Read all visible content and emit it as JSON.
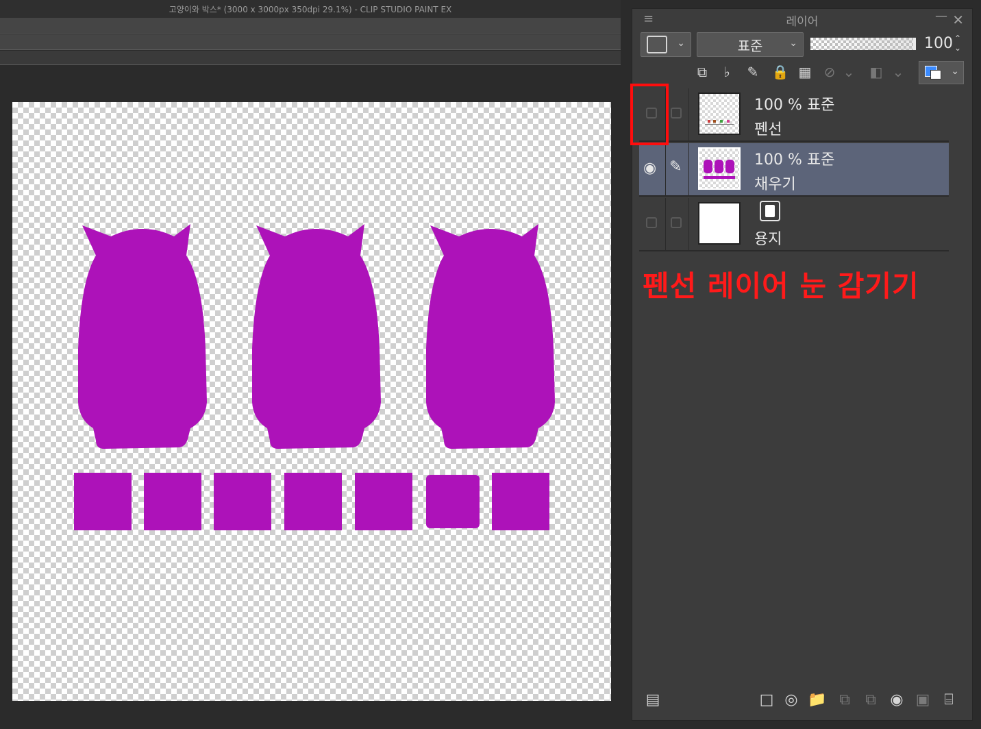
{
  "window": {
    "title": "고양이와 박스* (3000 x 3000px 350dpi 29.1%)  - CLIP STUDIO PAINT EX"
  },
  "layer_panel": {
    "title": "레이어",
    "blend_mode": "표준",
    "opacity": "100",
    "layers": [
      {
        "meta": "100 % 표준",
        "name": "펜선",
        "visible": false,
        "selected": false
      },
      {
        "meta": "100 % 표준",
        "name": "채우기",
        "visible": true,
        "selected": true
      },
      {
        "meta": "",
        "name": "용지",
        "visible": false,
        "selected": false
      }
    ]
  },
  "annotation": {
    "text": "펜선 레이어 눈 감기기",
    "color": "#ff1a1a"
  },
  "colors": {
    "fill_purple": "#ad12b9",
    "selected_row": "#5c6479",
    "highlight_red": "#ff0d0d"
  },
  "icons": {
    "panel_menu": "≡",
    "minimize": "—",
    "close": "✕",
    "eye": "👁",
    "pen": "✎",
    "trash": "🗑"
  }
}
